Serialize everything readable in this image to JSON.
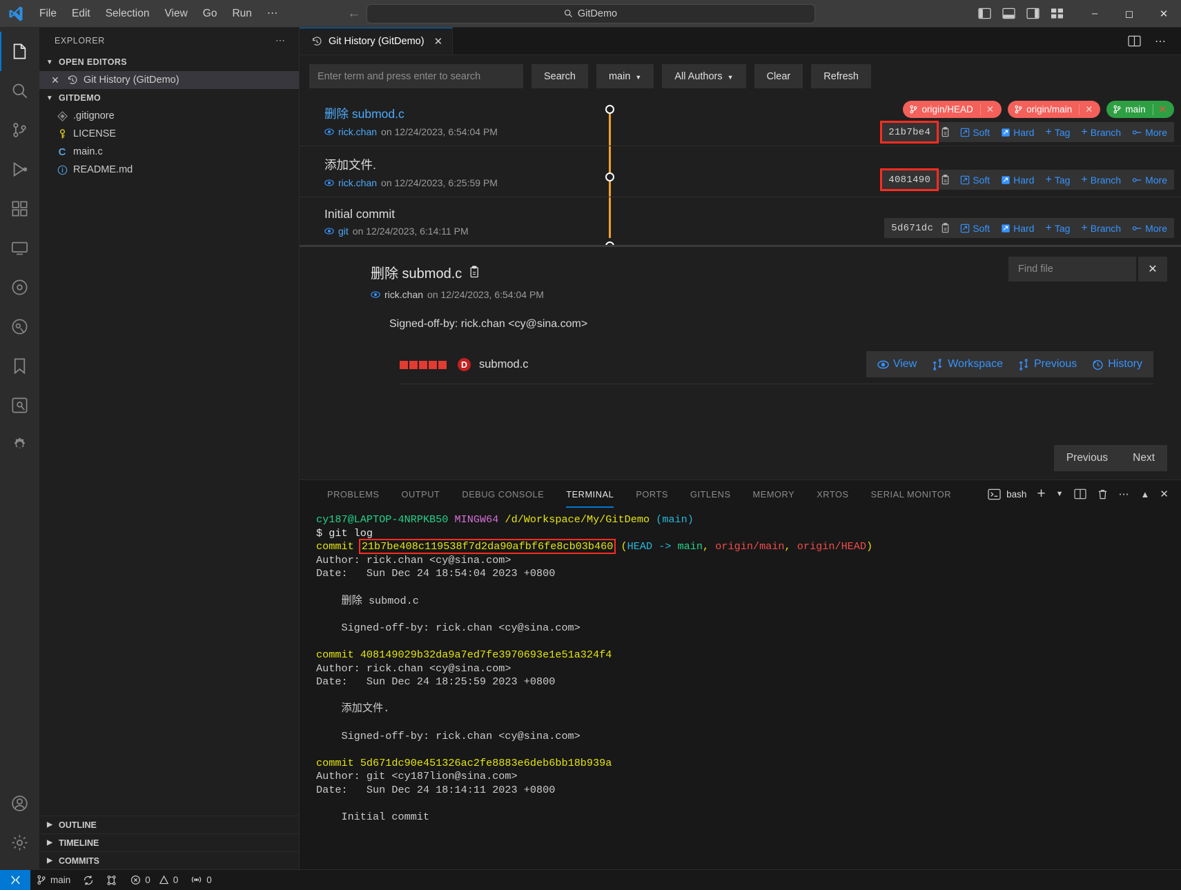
{
  "titlebar": {
    "menu": [
      "File",
      "Edit",
      "Selection",
      "View",
      "Go",
      "Run",
      "⋯"
    ],
    "search_value": "GitDemo",
    "search_icon": "search-icon"
  },
  "sidebar": {
    "header": "EXPLORER",
    "open_editors": {
      "label": "OPEN EDITORS",
      "items": [
        {
          "label": "Git History (GitDemo)",
          "icon": "history-icon",
          "selected": true
        }
      ]
    },
    "workspace": {
      "label": "GITDEMO",
      "files": [
        {
          "name": ".gitignore",
          "icon": "git-icon"
        },
        {
          "name": "LICENSE",
          "icon": "key-icon"
        },
        {
          "name": "main.c",
          "icon": "c-icon"
        },
        {
          "name": "README.md",
          "icon": "info-icon"
        }
      ]
    },
    "bottom_sections": [
      "OUTLINE",
      "TIMELINE",
      "COMMITS"
    ]
  },
  "editor": {
    "tab": {
      "label": "Git History (GitDemo)",
      "icon": "history-icon"
    },
    "toolbar": {
      "search_placeholder": "Enter term and press enter to search",
      "search_value": "",
      "search_button": "Search",
      "branch_select": "main",
      "authors_select": "All Authors",
      "clear_button": "Clear",
      "refresh_button": "Refresh"
    },
    "commits": [
      {
        "subject": "删除 submod.c",
        "subject_link": true,
        "author": "rick.chan",
        "date": "on 12/24/2023, 6:54:04 PM",
        "hash": "21b7be4",
        "hash_highlighted": true,
        "refs": [
          {
            "label": "origin/HEAD",
            "type": "remote"
          },
          {
            "label": "origin/main",
            "type": "remote"
          },
          {
            "label": "main",
            "type": "local"
          }
        ],
        "actions": [
          "Soft",
          "Hard",
          "Tag",
          "Branch",
          "More"
        ]
      },
      {
        "subject": "添加文件.",
        "subject_link": false,
        "author": "rick.chan",
        "date": "on 12/24/2023, 6:25:59 PM",
        "hash": "4081490",
        "hash_highlighted": true,
        "refs": [],
        "actions": [
          "Soft",
          "Hard",
          "Tag",
          "Branch",
          "More"
        ]
      },
      {
        "subject": "Initial commit",
        "subject_link": false,
        "author": "git",
        "date": "on 12/24/2023, 6:14:11 PM",
        "hash": "5d671dc",
        "hash_highlighted": false,
        "refs": [],
        "actions": [
          "Soft",
          "Hard",
          "Tag",
          "Branch",
          "More"
        ]
      }
    ],
    "detail": {
      "title": "删除 submod.c",
      "copy_icon": "clipboard-icon",
      "author": "rick.chan",
      "date": "on 12/24/2023, 6:54:04 PM",
      "signed_off": "Signed-off-by: rick.chan <cy@sina.com>",
      "find_file_placeholder": "Find file",
      "find_file_value": "",
      "close_label": "✕",
      "file": {
        "name": "submod.c",
        "status": "D"
      },
      "file_actions": [
        "View",
        "Workspace",
        "Previous",
        "History"
      ],
      "pagination": {
        "previous": "Previous",
        "next": "Next"
      }
    }
  },
  "panel": {
    "tabs": [
      "PROBLEMS",
      "OUTPUT",
      "DEBUG CONSOLE",
      "TERMINAL",
      "PORTS",
      "GITLENS",
      "MEMORY",
      "XRTOS",
      "SERIAL MONITOR"
    ],
    "active_tab": "TERMINAL",
    "shell": "bash",
    "terminal": {
      "prompt_user": "cy187@LAPTOP-4NRPKB50",
      "prompt_shell": "MINGW64",
      "prompt_path": "/d/Workspace/My/GitDemo",
      "prompt_branch": "(main)",
      "command": "$ git log",
      "entries": [
        {
          "commit_label": "commit",
          "hash": "21b7be408c119538f7d2da90afbf6fe8cb03b460",
          "hash_highlighted": true,
          "refs_open": "(",
          "head": "HEAD",
          "arrow": " -> ",
          "branch": "main",
          "sep1": ", ",
          "remote_main": "origin/main",
          "sep2": ", ",
          "remote_head": "origin/HEAD",
          "refs_close": ")",
          "author": "Author: rick.chan <cy@sina.com>",
          "date": "Date:   Sun Dec 24 18:54:04 2023 +0800",
          "message": "    删除 submod.c",
          "signed": "    Signed-off-by: rick.chan <cy@sina.com>"
        },
        {
          "commit_label": "commit",
          "hash": "408149029b32da9a7ed7fe3970693e1e51a324f4",
          "hash_highlighted": false,
          "author": "Author: rick.chan <cy@sina.com>",
          "date": "Date:   Sun Dec 24 18:25:59 2023 +0800",
          "message": "    添加文件.",
          "signed": "    Signed-off-by: rick.chan <cy@sina.com>"
        },
        {
          "commit_label": "commit",
          "hash": "5d671dc90e451326ac2fe8883e6deb6bb18b939a",
          "hash_highlighted": false,
          "author": "Author: git <cy187lion@sina.com>",
          "date": "Date:   Sun Dec 24 18:14:11 2023 +0800",
          "message": "    Initial commit",
          "signed": ""
        }
      ]
    }
  },
  "statusbar": {
    "branch": "main",
    "errors": "0",
    "warnings": "0",
    "ports": "0"
  },
  "colors": {
    "accent": "#0078d4",
    "link": "#3794ff",
    "remote_ref": "#f4605a",
    "local_ref": "#2ea043",
    "highlight": "#ff2d20",
    "graph": "#f0a030"
  }
}
